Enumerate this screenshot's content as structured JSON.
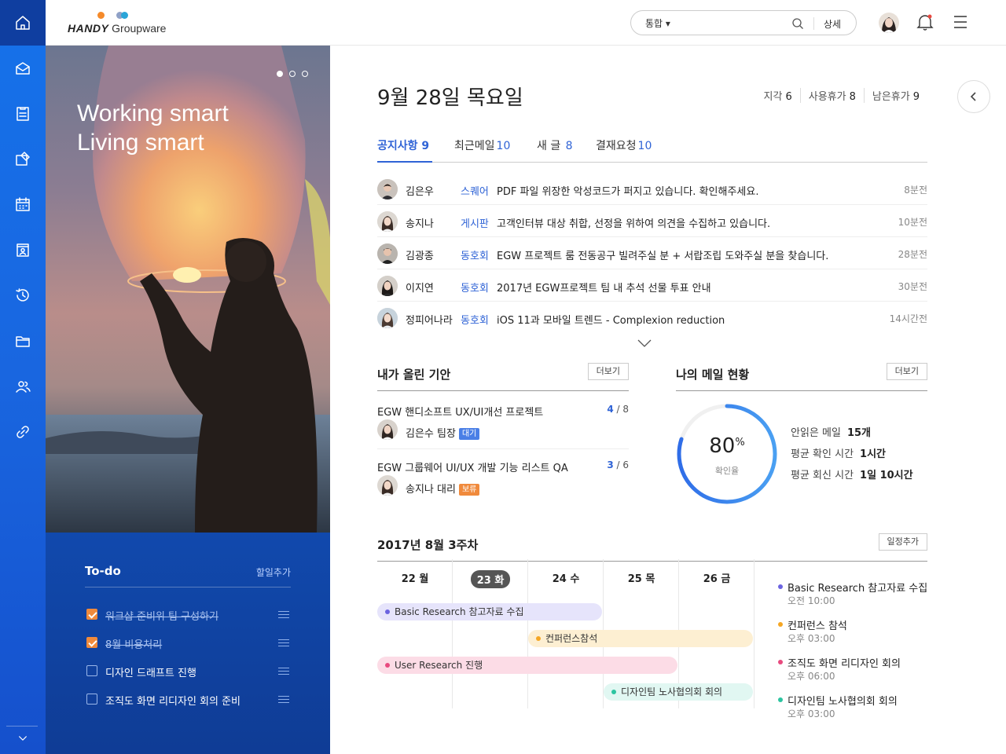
{
  "brand": {
    "logo_bold": "HANDY",
    "logo_rest": "Groupware",
    "dot_colors": [
      "#f58a2a",
      "#8fa1c7",
      "#2aa5d8"
    ]
  },
  "search": {
    "scope": "통합 ▾",
    "placeholder": "",
    "detail_label": "상세"
  },
  "hero": {
    "line1": "Working smart",
    "line2": "Living smart"
  },
  "todo": {
    "title": "To-do",
    "add_label": "할일추가",
    "items": [
      {
        "text": "워크샵 준비위 팀 구성하기",
        "done": true
      },
      {
        "text": "8월 비용처리",
        "done": true
      },
      {
        "text": "디자인 드래프트 진행",
        "done": false
      },
      {
        "text": "조직도 화면 리디자인 회의 준비",
        "done": false
      }
    ]
  },
  "date": {
    "title": "9월 28일 목요일"
  },
  "stats": [
    {
      "label": "지각",
      "value": "6"
    },
    {
      "label": "사용휴가",
      "value": "8"
    },
    {
      "label": "남은휴가",
      "value": "9"
    }
  ],
  "tabs": [
    {
      "label": "공지사항",
      "count": "9"
    },
    {
      "label": "최근메일",
      "count": "10"
    },
    {
      "label": "새 글",
      "count": "8"
    },
    {
      "label": "결재요청",
      "count": "10"
    }
  ],
  "feed": [
    {
      "name": "김은우",
      "source": "스퀘어",
      "title": "PDF 파일 위장한 악성코드가 퍼지고 있습니다. 확인해주세요.",
      "time": "8분전"
    },
    {
      "name": "송지나",
      "source": "게시판",
      "title": "고객인터뷰 대상 취합, 선정을 위하여 의견을 수집하고 있습니다.",
      "time": "10분전"
    },
    {
      "name": "김광종",
      "source": "동호회",
      "title": "EGW 프로젝트 룸 전동공구 빌려주실 분 + 서랍조립 도와주실 분을 찾습니다.",
      "time": "28분전"
    },
    {
      "name": "이지연",
      "source": "동호회",
      "title": "2017년 EGW프로젝트 팀 내 추석 선물 투표 안내",
      "time": "30분전"
    },
    {
      "name": "정피어나라",
      "source": "동호회",
      "title": "iOS 11과 모바일 트렌드 - Complexion reduction",
      "time": "14시간전"
    }
  ],
  "projects": {
    "title": "내가 올린 기안",
    "more_label": "더보기",
    "items": [
      {
        "title": "EGW 핸디소프트 UX/UI개선 프로젝트",
        "done": "4",
        "total": "/ 8",
        "person": "김은수 팀장",
        "badge": "대기",
        "badge_color": "#4a7fe6"
      },
      {
        "title": "EGW 그룹웨어 UI/UX 개발 기능 리스트 QA",
        "done": "3",
        "total": "/ 6",
        "person": "송지나 대리",
        "badge": "보류",
        "badge_color": "#f08a3c"
      }
    ]
  },
  "mail": {
    "title": "나의 메일 현황",
    "more_label": "더보기",
    "percent": "80",
    "percent_unit": "%",
    "percent_label": "확인율",
    "percent_value": 0.8,
    "rows": [
      {
        "label": "안읽은 메일",
        "value": "15개"
      },
      {
        "label": "평균 확인 시간",
        "value": "1시간"
      },
      {
        "label": "평균 회신 시간",
        "value": "1일 10시간"
      }
    ]
  },
  "calendar": {
    "title": "2017년 8월 3주차",
    "add_label": "일정추가",
    "days": [
      "22 월",
      "23 화",
      "24 수",
      "25 목",
      "26 금"
    ],
    "events": [
      {
        "title": "Basic Research 참고자료 수집",
        "bg": "#e6e4fb",
        "dot": "#6b63e0"
      },
      {
        "title": "컨퍼런스참석",
        "bg": "#fdefd2",
        "dot": "#f5a623"
      },
      {
        "title": "User Research 진행",
        "bg": "#fcdce6",
        "dot": "#e84a7f"
      },
      {
        "title": "디자인팀 노사협의회 회의",
        "bg": "#e1f7f2",
        "dot": "#2cc4a0"
      }
    ],
    "agenda": [
      {
        "title": "Basic Research 참고자료 수집",
        "time": "오전 10:00",
        "dot": "#6b63e0"
      },
      {
        "title": "컨퍼런스 참석",
        "time": "오후 03:00",
        "dot": "#f5a623"
      },
      {
        "title": "조직도 화면 리디자인 회의",
        "time": "오후 06:00",
        "dot": "#e84a7f"
      },
      {
        "title": "디자인팀 노사협의회 회의",
        "time": "오후 03:00",
        "dot": "#2cc4a0"
      }
    ]
  }
}
